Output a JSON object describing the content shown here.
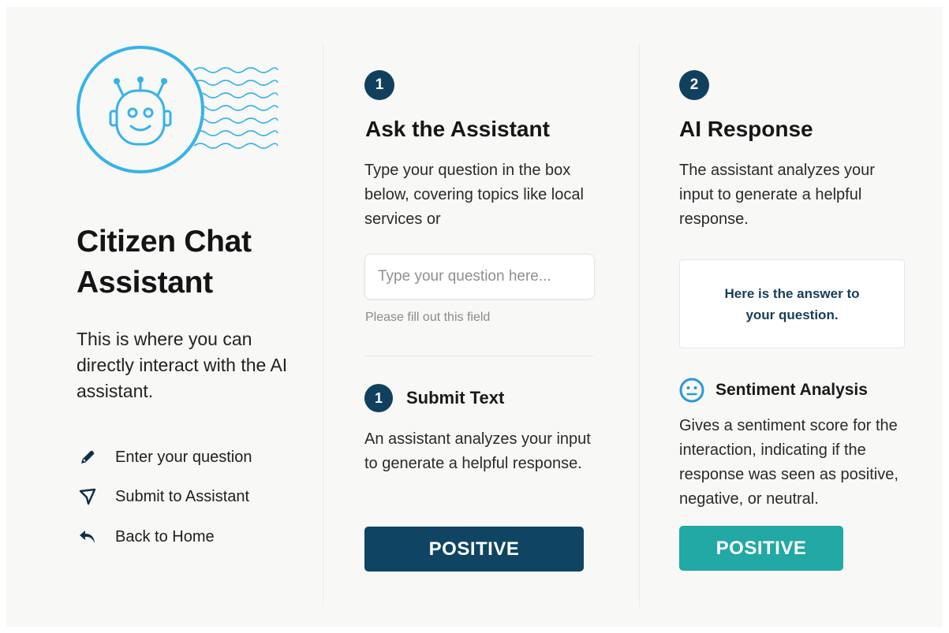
{
  "colors": {
    "navy": "#10405e",
    "teal": "#22a8a5",
    "sky": "#35b3e8"
  },
  "sidebar": {
    "avatar_icon": "robot-icon",
    "title": "Citizen Chat Assistant",
    "description": "This is where you can directly interact with the AI assistant.",
    "nav": [
      {
        "label": "Enter your question",
        "icon": "pencil-icon"
      },
      {
        "label": "Submit to Assistant",
        "icon": "send-icon"
      },
      {
        "label": "Back to Home",
        "icon": "back-arrow-icon"
      }
    ]
  },
  "ask": {
    "step": "1",
    "heading": "Ask the Assistant",
    "description": "Type your question in the box below, covering topics like local services or",
    "input_placeholder": "Type your question here...",
    "input_value": "",
    "validation": "Please fill out this field",
    "submit": {
      "step": "1",
      "heading": "Submit Text",
      "description": "An assistant analyzes your input to generate a helpful response.",
      "button_label": "POSITIVE"
    }
  },
  "response": {
    "step": "2",
    "heading": "AI Response",
    "description": "The assistant analyzes your input to generate a helpful response.",
    "answer": "Here is the answer to your question.",
    "sentiment": {
      "icon": "neutral-face-icon",
      "heading": "Sentiment Analysis",
      "description": "Gives a sentiment score for the interaction, indicating if the response was seen as positive, negative, or neutral.",
      "button_label": "POSITIVE"
    }
  }
}
